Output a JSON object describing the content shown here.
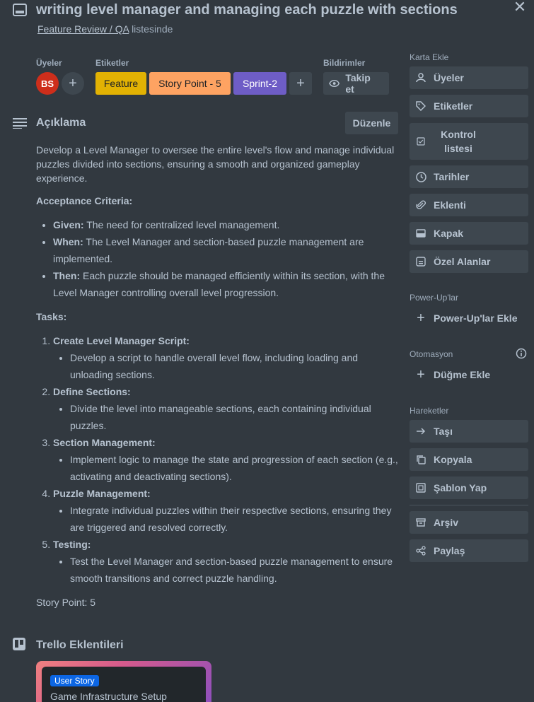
{
  "header": {
    "title": "writing level manager and managing each puzzle with sections",
    "list_name": "Feature Review / QA",
    "list_suffix": "listesinde",
    "close_symbol": "✕"
  },
  "members": {
    "label": "Üyeler",
    "avatar_initials": "BS",
    "avatar_color": "#ce2e1b"
  },
  "labels": {
    "label": "Etiketler",
    "items": [
      {
        "text": "Feature",
        "color": "#e2b203"
      },
      {
        "text": "Story Point - 5",
        "color": "#fea362"
      },
      {
        "text": "Sprint-2",
        "color": "#6e5dc6"
      }
    ]
  },
  "notifications": {
    "label": "Bildirimler",
    "watch_label": "Takip et"
  },
  "description": {
    "heading": "Açıklama",
    "edit_label": "Düzenle",
    "intro": "Develop a Level Manager to oversee the entire level's flow and manage individual puzzles divided into sections, ensuring a smooth and organized gameplay experience.",
    "acceptance_heading": "Acceptance Criteria:",
    "criteria": [
      {
        "key": "Given:",
        "text": " The need for centralized level management."
      },
      {
        "key": "When:",
        "text": " The Level Manager and section-based puzzle management are implemented."
      },
      {
        "key": "Then:",
        "text": " Each puzzle should be managed efficiently within its section, with the Level Manager controlling overall level progression."
      }
    ],
    "tasks_heading": "Tasks:",
    "tasks": [
      {
        "title": "Create Level Manager Script:",
        "detail": "Develop a script to handle overall level flow, including loading and unloading sections."
      },
      {
        "title": "Define Sections:",
        "detail": "Divide the level into manageable sections, each containing individual puzzles."
      },
      {
        "title": "Section Management:",
        "detail": "Implement logic to manage the state and progression of each section (e.g., activating and deactivating sections)."
      },
      {
        "title": "Puzzle Management:",
        "detail": "Integrate individual puzzles within their respective sections, ensuring they are triggered and resolved correctly."
      },
      {
        "title": "Testing:",
        "detail": "Test the Level Manager and section-based puzzle management to ensure smooth transitions and correct puzzle handling."
      }
    ],
    "story_point": "Story Point: 5"
  },
  "powerups_section": {
    "heading": "Trello Eklentileri",
    "card_badge": "User Story",
    "card_title": "Game Infrastructure Setup"
  },
  "sidebar": {
    "add_heading": "Karta Ekle",
    "add_items": [
      {
        "label": "Üyeler",
        "icon": "person-icon"
      },
      {
        "label": "Etiketler",
        "icon": "tag-icon"
      },
      {
        "label": "Kontrol listesi",
        "icon": "checklist-icon"
      },
      {
        "label": "Tarihler",
        "icon": "clock-icon"
      },
      {
        "label": "Eklenti",
        "icon": "paperclip-icon"
      },
      {
        "label": "Kapak",
        "icon": "cover-icon"
      },
      {
        "label": "Özel Alanlar",
        "icon": "custom-fields-icon"
      }
    ],
    "powerups_heading": "Power-Up'lar",
    "powerups_add": "Power-Up'lar Ekle",
    "automation_heading": "Otomasyon",
    "automation_add": "Düğme Ekle",
    "actions_heading": "Hareketler",
    "actions": [
      {
        "label": "Taşı",
        "icon": "arrow-right-icon"
      },
      {
        "label": "Kopyala",
        "icon": "copy-icon"
      },
      {
        "label": "Şablon Yap",
        "icon": "template-icon"
      },
      {
        "label": "Arşiv",
        "icon": "archive-icon"
      },
      {
        "label": "Paylaş",
        "icon": "share-icon"
      }
    ]
  }
}
